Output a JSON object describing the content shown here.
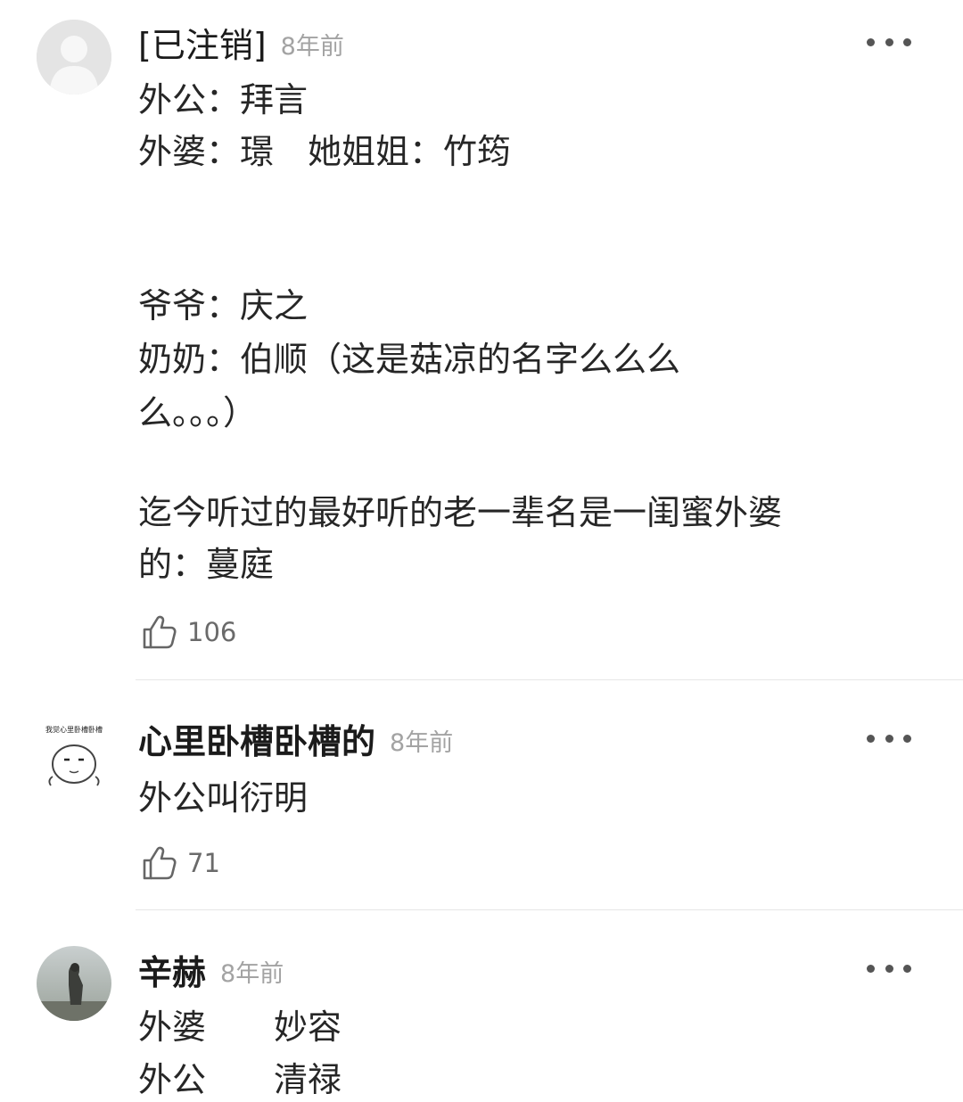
{
  "comments": [
    {
      "username": "[已注销]",
      "time": "8年前",
      "lines": [
        "外公：拜言",
        "外婆：璟　她姐姐：竹筠",
        "",
        "",
        "爷爷：庆之",
        "奶奶：伯顺（这是菇凉的名字么么么",
        "么。。。）",
        "",
        "迄今听过的最好听的老一辈名是一闺蜜外婆",
        "的：蔓庭"
      ],
      "likes": "106"
    },
    {
      "username": "心里卧槽卧槽的",
      "time": "8年前",
      "avatar_text": "我觉心里卧槽卧槽",
      "lines": [
        "外公叫衍明"
      ],
      "likes": "71"
    },
    {
      "username": "辛赫",
      "time": "8年前",
      "lines": [
        "外婆　　妙容",
        "外公　　清禄"
      ]
    }
  ],
  "icons": {
    "more": "more-dots-icon",
    "like": "thumbs-up-icon"
  }
}
